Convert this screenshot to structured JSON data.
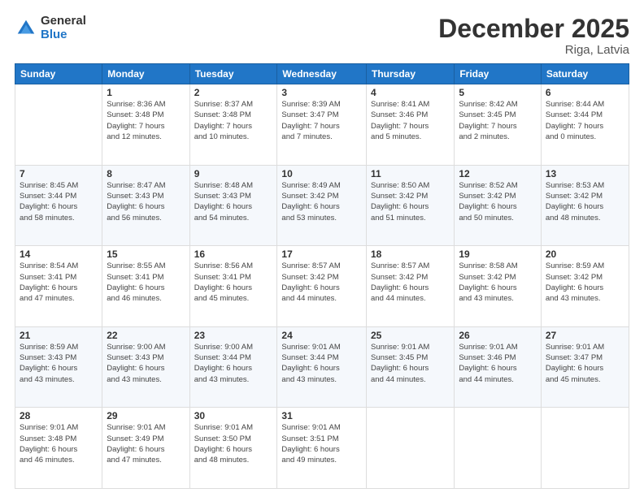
{
  "header": {
    "logo_general": "General",
    "logo_blue": "Blue",
    "month_title": "December 2025",
    "location": "Riga, Latvia"
  },
  "days_of_week": [
    "Sunday",
    "Monday",
    "Tuesday",
    "Wednesday",
    "Thursday",
    "Friday",
    "Saturday"
  ],
  "weeks": [
    [
      {
        "day": "",
        "sunrise": "",
        "sunset": "",
        "daylight": ""
      },
      {
        "day": "1",
        "sunrise": "Sunrise: 8:36 AM",
        "sunset": "Sunset: 3:48 PM",
        "daylight": "Daylight: 7 hours and 12 minutes."
      },
      {
        "day": "2",
        "sunrise": "Sunrise: 8:37 AM",
        "sunset": "Sunset: 3:48 PM",
        "daylight": "Daylight: 7 hours and 10 minutes."
      },
      {
        "day": "3",
        "sunrise": "Sunrise: 8:39 AM",
        "sunset": "Sunset: 3:47 PM",
        "daylight": "Daylight: 7 hours and 7 minutes."
      },
      {
        "day": "4",
        "sunrise": "Sunrise: 8:41 AM",
        "sunset": "Sunset: 3:46 PM",
        "daylight": "Daylight: 7 hours and 5 minutes."
      },
      {
        "day": "5",
        "sunrise": "Sunrise: 8:42 AM",
        "sunset": "Sunset: 3:45 PM",
        "daylight": "Daylight: 7 hours and 2 minutes."
      },
      {
        "day": "6",
        "sunrise": "Sunrise: 8:44 AM",
        "sunset": "Sunset: 3:44 PM",
        "daylight": "Daylight: 7 hours and 0 minutes."
      }
    ],
    [
      {
        "day": "7",
        "sunrise": "Sunrise: 8:45 AM",
        "sunset": "Sunset: 3:44 PM",
        "daylight": "Daylight: 6 hours and 58 minutes."
      },
      {
        "day": "8",
        "sunrise": "Sunrise: 8:47 AM",
        "sunset": "Sunset: 3:43 PM",
        "daylight": "Daylight: 6 hours and 56 minutes."
      },
      {
        "day": "9",
        "sunrise": "Sunrise: 8:48 AM",
        "sunset": "Sunset: 3:43 PM",
        "daylight": "Daylight: 6 hours and 54 minutes."
      },
      {
        "day": "10",
        "sunrise": "Sunrise: 8:49 AM",
        "sunset": "Sunset: 3:42 PM",
        "daylight": "Daylight: 6 hours and 53 minutes."
      },
      {
        "day": "11",
        "sunrise": "Sunrise: 8:50 AM",
        "sunset": "Sunset: 3:42 PM",
        "daylight": "Daylight: 6 hours and 51 minutes."
      },
      {
        "day": "12",
        "sunrise": "Sunrise: 8:52 AM",
        "sunset": "Sunset: 3:42 PM",
        "daylight": "Daylight: 6 hours and 50 minutes."
      },
      {
        "day": "13",
        "sunrise": "Sunrise: 8:53 AM",
        "sunset": "Sunset: 3:42 PM",
        "daylight": "Daylight: 6 hours and 48 minutes."
      }
    ],
    [
      {
        "day": "14",
        "sunrise": "Sunrise: 8:54 AM",
        "sunset": "Sunset: 3:41 PM",
        "daylight": "Daylight: 6 hours and 47 minutes."
      },
      {
        "day": "15",
        "sunrise": "Sunrise: 8:55 AM",
        "sunset": "Sunset: 3:41 PM",
        "daylight": "Daylight: 6 hours and 46 minutes."
      },
      {
        "day": "16",
        "sunrise": "Sunrise: 8:56 AM",
        "sunset": "Sunset: 3:41 PM",
        "daylight": "Daylight: 6 hours and 45 minutes."
      },
      {
        "day": "17",
        "sunrise": "Sunrise: 8:57 AM",
        "sunset": "Sunset: 3:42 PM",
        "daylight": "Daylight: 6 hours and 44 minutes."
      },
      {
        "day": "18",
        "sunrise": "Sunrise: 8:57 AM",
        "sunset": "Sunset: 3:42 PM",
        "daylight": "Daylight: 6 hours and 44 minutes."
      },
      {
        "day": "19",
        "sunrise": "Sunrise: 8:58 AM",
        "sunset": "Sunset: 3:42 PM",
        "daylight": "Daylight: 6 hours and 43 minutes."
      },
      {
        "day": "20",
        "sunrise": "Sunrise: 8:59 AM",
        "sunset": "Sunset: 3:42 PM",
        "daylight": "Daylight: 6 hours and 43 minutes."
      }
    ],
    [
      {
        "day": "21",
        "sunrise": "Sunrise: 8:59 AM",
        "sunset": "Sunset: 3:43 PM",
        "daylight": "Daylight: 6 hours and 43 minutes."
      },
      {
        "day": "22",
        "sunrise": "Sunrise: 9:00 AM",
        "sunset": "Sunset: 3:43 PM",
        "daylight": "Daylight: 6 hours and 43 minutes."
      },
      {
        "day": "23",
        "sunrise": "Sunrise: 9:00 AM",
        "sunset": "Sunset: 3:44 PM",
        "daylight": "Daylight: 6 hours and 43 minutes."
      },
      {
        "day": "24",
        "sunrise": "Sunrise: 9:01 AM",
        "sunset": "Sunset: 3:44 PM",
        "daylight": "Daylight: 6 hours and 43 minutes."
      },
      {
        "day": "25",
        "sunrise": "Sunrise: 9:01 AM",
        "sunset": "Sunset: 3:45 PM",
        "daylight": "Daylight: 6 hours and 44 minutes."
      },
      {
        "day": "26",
        "sunrise": "Sunrise: 9:01 AM",
        "sunset": "Sunset: 3:46 PM",
        "daylight": "Daylight: 6 hours and 44 minutes."
      },
      {
        "day": "27",
        "sunrise": "Sunrise: 9:01 AM",
        "sunset": "Sunset: 3:47 PM",
        "daylight": "Daylight: 6 hours and 45 minutes."
      }
    ],
    [
      {
        "day": "28",
        "sunrise": "Sunrise: 9:01 AM",
        "sunset": "Sunset: 3:48 PM",
        "daylight": "Daylight: 6 hours and 46 minutes."
      },
      {
        "day": "29",
        "sunrise": "Sunrise: 9:01 AM",
        "sunset": "Sunset: 3:49 PM",
        "daylight": "Daylight: 6 hours and 47 minutes."
      },
      {
        "day": "30",
        "sunrise": "Sunrise: 9:01 AM",
        "sunset": "Sunset: 3:50 PM",
        "daylight": "Daylight: 6 hours and 48 minutes."
      },
      {
        "day": "31",
        "sunrise": "Sunrise: 9:01 AM",
        "sunset": "Sunset: 3:51 PM",
        "daylight": "Daylight: 6 hours and 49 minutes."
      },
      {
        "day": "",
        "sunrise": "",
        "sunset": "",
        "daylight": ""
      },
      {
        "day": "",
        "sunrise": "",
        "sunset": "",
        "daylight": ""
      },
      {
        "day": "",
        "sunrise": "",
        "sunset": "",
        "daylight": ""
      }
    ]
  ]
}
